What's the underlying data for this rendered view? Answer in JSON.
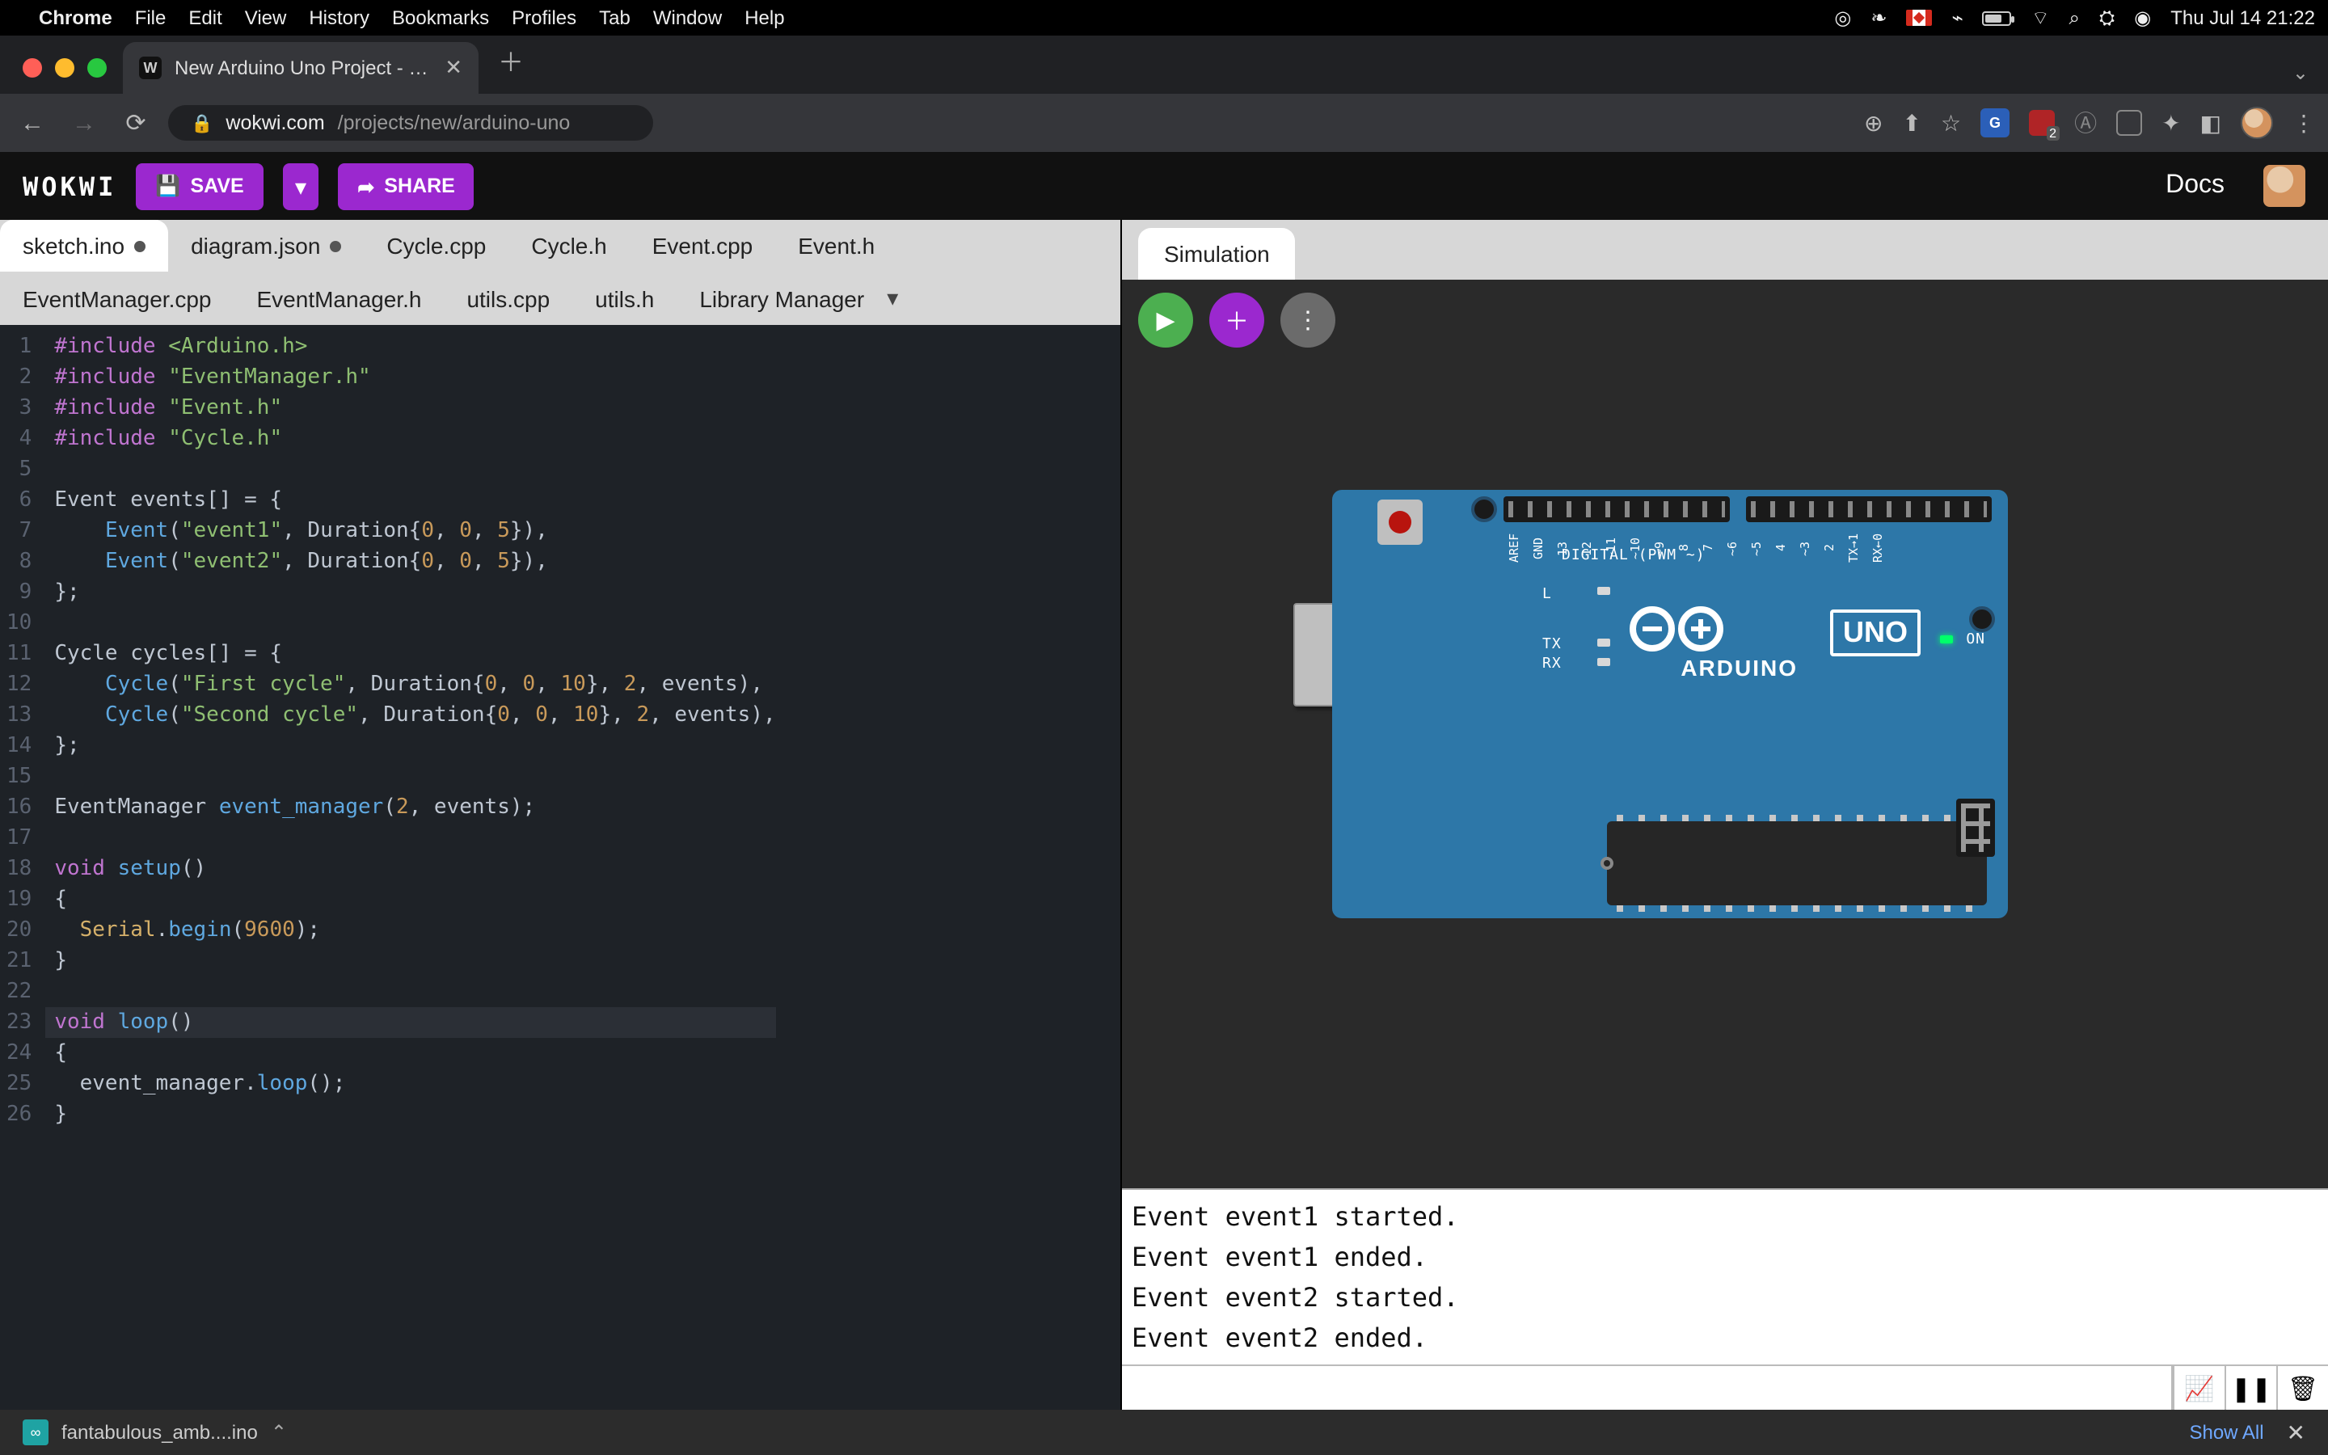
{
  "mac_menu": {
    "app": "Chrome",
    "items": [
      "File",
      "Edit",
      "View",
      "History",
      "Bookmarks",
      "Profiles",
      "Tab",
      "Window",
      "Help"
    ],
    "clock": "Thu Jul 14  21:22"
  },
  "browser": {
    "tab_title": "New Arduino Uno Project - Wo",
    "url_host": "wokwi.com",
    "url_path": "/projects/new/arduino-uno"
  },
  "header": {
    "logo": "WOKWI",
    "save": "SAVE",
    "share": "SHARE",
    "docs": "Docs"
  },
  "tabs": {
    "row1": [
      {
        "label": "sketch.ino",
        "dirty": true,
        "active": true
      },
      {
        "label": "diagram.json",
        "dirty": true
      },
      {
        "label": "Cycle.cpp"
      },
      {
        "label": "Cycle.h"
      },
      {
        "label": "Event.cpp"
      },
      {
        "label": "Event.h"
      }
    ],
    "row2": [
      {
        "label": "EventManager.cpp"
      },
      {
        "label": "EventManager.h"
      },
      {
        "label": "utils.cpp"
      },
      {
        "label": "utils.h"
      },
      {
        "label": "Library Manager",
        "lib": true
      }
    ]
  },
  "code": [
    {
      "n": 1,
      "html": "<span class='kw'>#include</span> <span class='inc'>&lt;Arduino.h&gt;</span>"
    },
    {
      "n": 2,
      "html": "<span class='kw'>#include</span> <span class='inc'>\"EventManager.h\"</span>"
    },
    {
      "n": 3,
      "html": "<span class='kw'>#include</span> <span class='inc'>\"Event.h\"</span>"
    },
    {
      "n": 4,
      "html": "<span class='kw'>#include</span> <span class='inc'>\"Cycle.h\"</span>"
    },
    {
      "n": 5,
      "html": ""
    },
    {
      "n": 6,
      "html": "Event events[] = {"
    },
    {
      "n": 7,
      "html": "    <span class='fn'>Event</span>(<span class='str'>\"event1\"</span>, Duration{<span class='num'>0</span>, <span class='num'>0</span>, <span class='num'>5</span>}),"
    },
    {
      "n": 8,
      "html": "    <span class='fn'>Event</span>(<span class='str'>\"event2\"</span>, Duration{<span class='num'>0</span>, <span class='num'>0</span>, <span class='num'>5</span>}),"
    },
    {
      "n": 9,
      "html": "};"
    },
    {
      "n": 10,
      "html": ""
    },
    {
      "n": 11,
      "html": "Cycle cycles[] = {"
    },
    {
      "n": 12,
      "html": "    <span class='fn'>Cycle</span>(<span class='str'>\"First cycle\"</span>, Duration{<span class='num'>0</span>, <span class='num'>0</span>, <span class='num'>10</span>}, <span class='num'>2</span>, events),"
    },
    {
      "n": 13,
      "html": "    <span class='fn'>Cycle</span>(<span class='str'>\"Second cycle\"</span>, Duration{<span class='num'>0</span>, <span class='num'>0</span>, <span class='num'>10</span>}, <span class='num'>2</span>, events),"
    },
    {
      "n": 14,
      "html": "};"
    },
    {
      "n": 15,
      "html": ""
    },
    {
      "n": 16,
      "html": "EventManager <span class='fn'>event_manager</span>(<span class='num'>2</span>, events);"
    },
    {
      "n": 17,
      "html": ""
    },
    {
      "n": 18,
      "html": "<span class='kw'>void</span> <span class='fn'>setup</span>()"
    },
    {
      "n": 19,
      "html": "{"
    },
    {
      "n": 20,
      "html": "  <span class='ty'>Serial</span>.<span class='fn'>begin</span>(<span class='num'>9600</span>);"
    },
    {
      "n": 21,
      "html": "}"
    },
    {
      "n": 22,
      "html": ""
    },
    {
      "n": 23,
      "html": "<span class='kw'>void</span> <span class='fn'>loop</span>()",
      "hl": true
    },
    {
      "n": 24,
      "html": "{"
    },
    {
      "n": 25,
      "html": "  event_manager.<span class='fn'>loop</span>();"
    },
    {
      "n": 26,
      "html": "}"
    }
  ],
  "sim": {
    "tab": "Simulation",
    "board": {
      "name": "UNO",
      "brand": "ARDUINO",
      "on_label": "ON",
      "tx": "TX",
      "rx": "RX",
      "l": "L",
      "digital": "DIGITAL (PWM ~)",
      "pins_top": [
        "AREF",
        "GND",
        "13",
        "12",
        "~11",
        "~10",
        "~9",
        "8",
        "7",
        "~6",
        "~5",
        "4",
        "~3",
        "2",
        "TX→1",
        "RX←0"
      ]
    },
    "serial_lines": [
      "Event event1 started.",
      "Event event1 ended.",
      "Event event2 started.",
      "Event event2 ended."
    ]
  },
  "download_bar": {
    "filename": "fantabulous_amb....ino",
    "show_all": "Show All"
  }
}
